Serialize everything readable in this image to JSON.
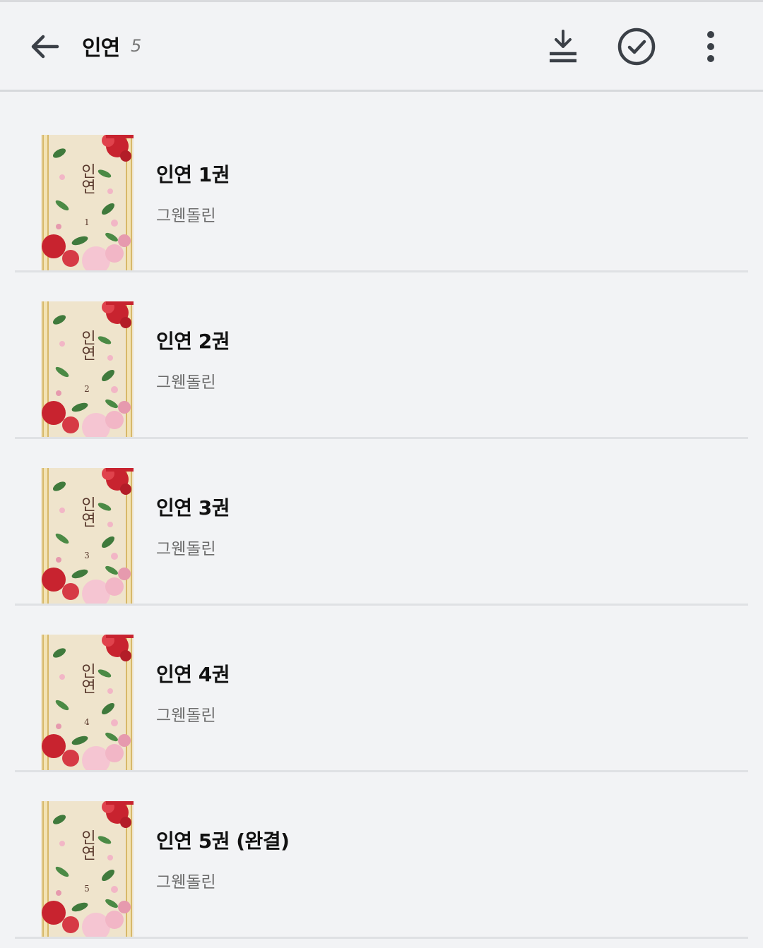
{
  "header": {
    "title": "인연",
    "count": "5",
    "back_icon": "arrow-left-icon",
    "actions": [
      {
        "name": "download-all",
        "icon": "download-icon"
      },
      {
        "name": "select",
        "icon": "check-circle-icon"
      },
      {
        "name": "more-options",
        "icon": "more-vertical-icon"
      }
    ]
  },
  "books": [
    {
      "title": "인연 1권",
      "author": "그웬돌린",
      "volume": "1"
    },
    {
      "title": "인연 2권",
      "author": "그웬돌린",
      "volume": "2"
    },
    {
      "title": "인연 3권",
      "author": "그웬돌린",
      "volume": "3"
    },
    {
      "title": "인연 4권",
      "author": "그웬돌린",
      "volume": "4"
    },
    {
      "title": "인연 5권 (완결)",
      "author": "그웬돌린",
      "volume": "5"
    }
  ],
  "cover": {
    "title": "인연",
    "colors": {
      "background": "#efe4cc",
      "border": "#c9a24a",
      "flower_red": "#c8232f",
      "flower_pink": "#f2b6c6",
      "leaf": "#3f7a3c"
    }
  }
}
